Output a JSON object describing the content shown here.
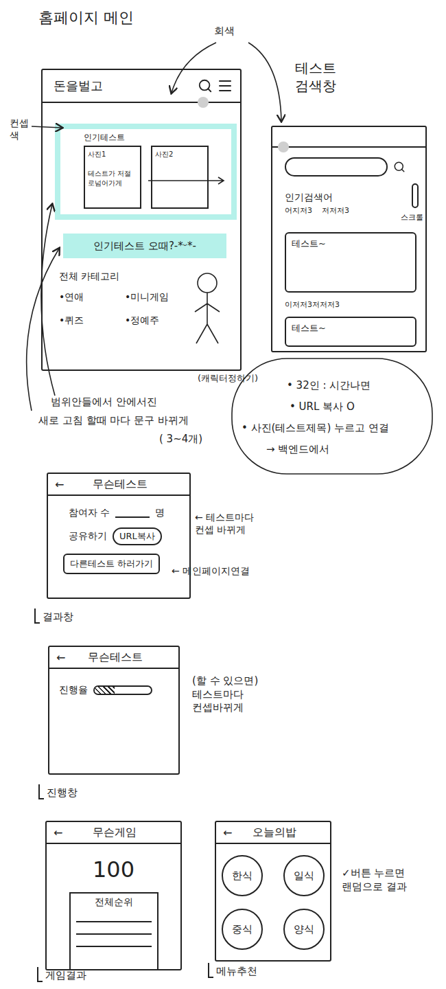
{
  "page_title": "홈페이지 메인",
  "gray_note": "회색",
  "search_page_title": [
    "테스트",
    "검색창"
  ],
  "concept_color_note": [
    "컨셉",
    "색"
  ],
  "main": {
    "title": "돈을벌고",
    "popular_label": "인기테스트",
    "cards": [
      {
        "photo": "사진1",
        "caption": "테스트가 저절로넘어가게"
      },
      {
        "photo": "사진2"
      }
    ],
    "banner": "인기테스트 오때?-*ᵕ*-",
    "categories_title": "전체 카테고리",
    "categories": [
      "•연애",
      "•미니게임",
      "•퀴즈",
      "•정예주"
    ],
    "character_note": "(캐릭터정하기)"
  },
  "refresh_note": [
    "범위안들에서 안에서진",
    "새로 고침 할때 마다 문구 바뀌게",
    "( 3~4개)"
  ],
  "search_page": {
    "popular_label": "인기검색어",
    "keywords": [
      "어지저3",
      "저저저3"
    ],
    "scroll_label": "스크롤",
    "results": [
      {
        "title": "테스트~"
      },
      {
        "caption": "이저저3저저저3",
        "title": "테스트~"
      }
    ]
  },
  "cloud_note": [
    "• 32인 : 시간나면",
    "• URL 복사 O",
    "• 사진(테스트제목) 누르고 연결",
    "→ 백엔드에서"
  ],
  "result_screen": {
    "back": "←",
    "title": "무슨테스트",
    "participants_label": "참여자 수",
    "participants_unit": "명",
    "share_label": "공유하기",
    "copy_button": "URL복사",
    "other_button": "다른테스트 하러가기",
    "concept_note": [
      "← 테스트마다",
      "컨셉 바뀌게"
    ],
    "link_note": "← 메인페이지연결",
    "label": "결과창"
  },
  "progress_screen": {
    "back": "←",
    "title": "무슨테스트",
    "progress_label": "진행율",
    "level": 0.35,
    "note": [
      "(할 수 있으면)",
      "테스트마다",
      "컨셉바뀌게"
    ],
    "label": "진행창"
  },
  "game_screen": {
    "back": "←",
    "title": "무슨게임",
    "score": "100",
    "ranking_title": "전체순위",
    "label": "게임결과"
  },
  "menu_screen": {
    "back": "←",
    "title": "오늘의밥",
    "options": [
      "한식",
      "일식",
      "중식",
      "양식"
    ],
    "note": [
      "✓버튼 누르면",
      "랜덤으로 결과"
    ],
    "label": "메뉴추천"
  }
}
